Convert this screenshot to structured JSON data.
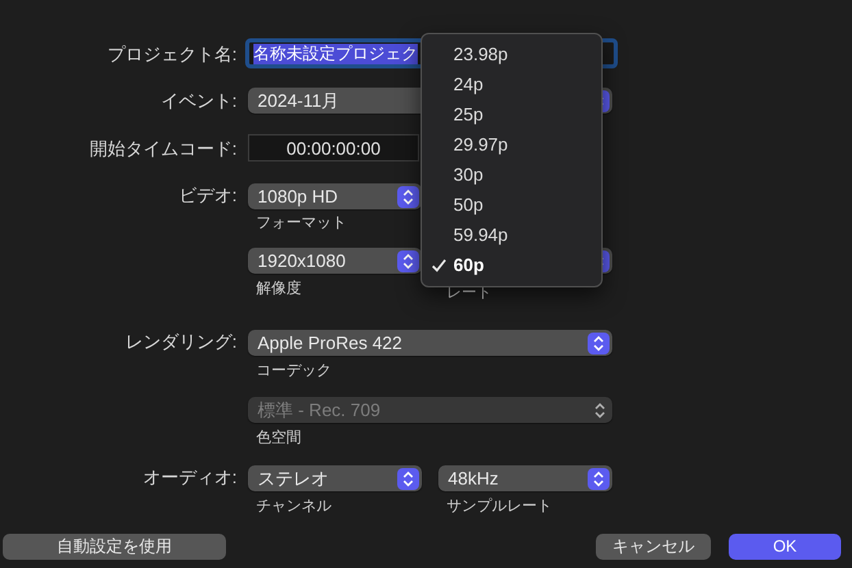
{
  "project_name": {
    "label": "プロジェクト名:",
    "value": "名称未設定プロジェク",
    "text_selected": true
  },
  "event": {
    "label": "イベント:",
    "value": "2024-11月"
  },
  "start_timecode": {
    "label": "開始タイムコード:",
    "value": "00:00:00:00"
  },
  "video": {
    "label": "ビデオ:",
    "format": {
      "value": "1080p HD",
      "caption": "フォーマット"
    },
    "resolution": {
      "value": "1920x1080",
      "caption": "解像度"
    },
    "rate": {
      "caption": "レート"
    }
  },
  "rendering": {
    "label": "レンダリング:",
    "codec": {
      "value": "Apple ProRes 422",
      "caption": "コーデック"
    },
    "color_space": {
      "value": "標準 - Rec. 709",
      "caption": "色空間",
      "disabled": true
    }
  },
  "audio": {
    "label": "オーディオ:",
    "channels": {
      "value": "ステレオ",
      "caption": "チャンネル"
    },
    "sample_rate": {
      "value": "48kHz",
      "caption": "サンプルレート"
    }
  },
  "rate_menu": {
    "items": [
      {
        "label": "23.98p",
        "selected": false
      },
      {
        "label": "24p",
        "selected": false
      },
      {
        "label": "25p",
        "selected": false
      },
      {
        "label": "29.97p",
        "selected": false
      },
      {
        "label": "30p",
        "selected": false
      },
      {
        "label": "50p",
        "selected": false
      },
      {
        "label": "59.94p",
        "selected": false
      },
      {
        "label": "60p",
        "selected": true
      }
    ]
  },
  "buttons": [
    {
      "label": "自動設定を使用",
      "kind": "secondary"
    },
    {
      "label": "キャンセル",
      "kind": "secondary"
    },
    {
      "label": "OK",
      "kind": "primary"
    }
  ]
}
